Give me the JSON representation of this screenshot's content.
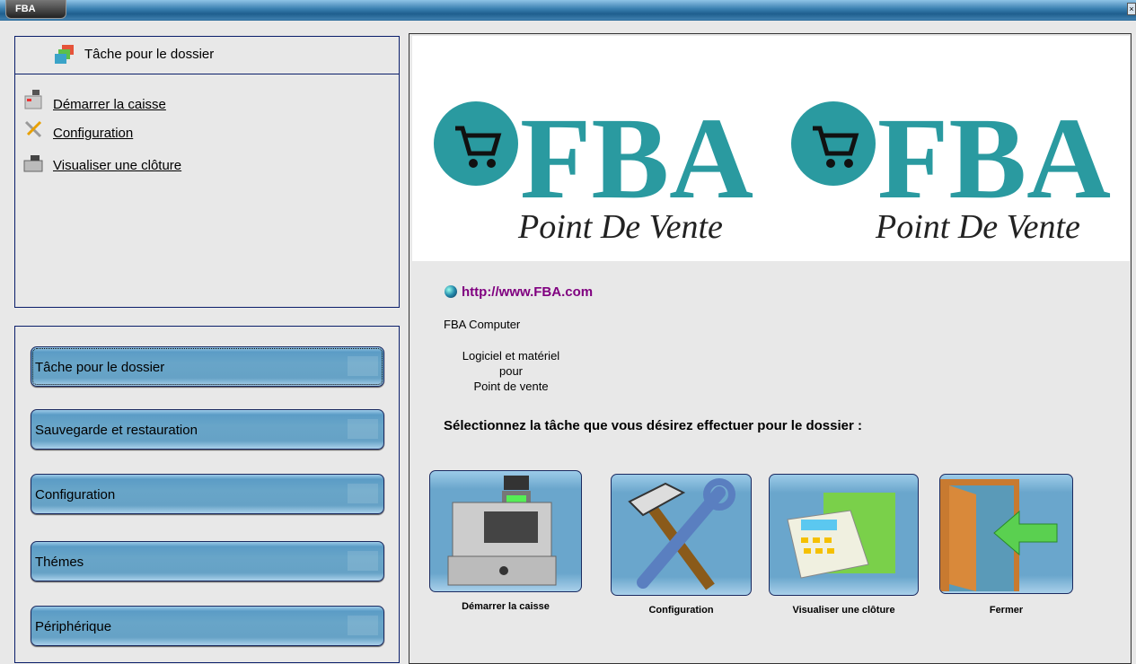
{
  "window": {
    "app_tab": "FBA",
    "close_icon": "close-icon"
  },
  "tasks_panel": {
    "title": "Tâche pour le dossier",
    "links": [
      "Démarrer la caisse",
      "Configuration",
      "Visualiser une clôture"
    ]
  },
  "nav": {
    "buttons": [
      "Tâche pour le dossier",
      "Sauvegarde et restauration",
      "Configuration",
      "Thémes",
      "Périphérique"
    ],
    "active": 0
  },
  "main": {
    "logo": {
      "brand": "FBA",
      "tagline": "Point De Vente"
    },
    "url": "http://www.FBA.com",
    "company": "FBA Computer",
    "desc": [
      "Logiciel et matériel",
      "pour",
      "Point de vente"
    ],
    "prompt": "Sélectionnez la tâche que vous désirez effectuer pour le dossier :",
    "actions": [
      "Démarrer la caisse",
      "Configuration",
      "Visualiser une clôture",
      "Fermer"
    ]
  },
  "colors": {
    "accent": "#2a9aa0",
    "link": "#800080",
    "border": "#0a1e6a"
  }
}
